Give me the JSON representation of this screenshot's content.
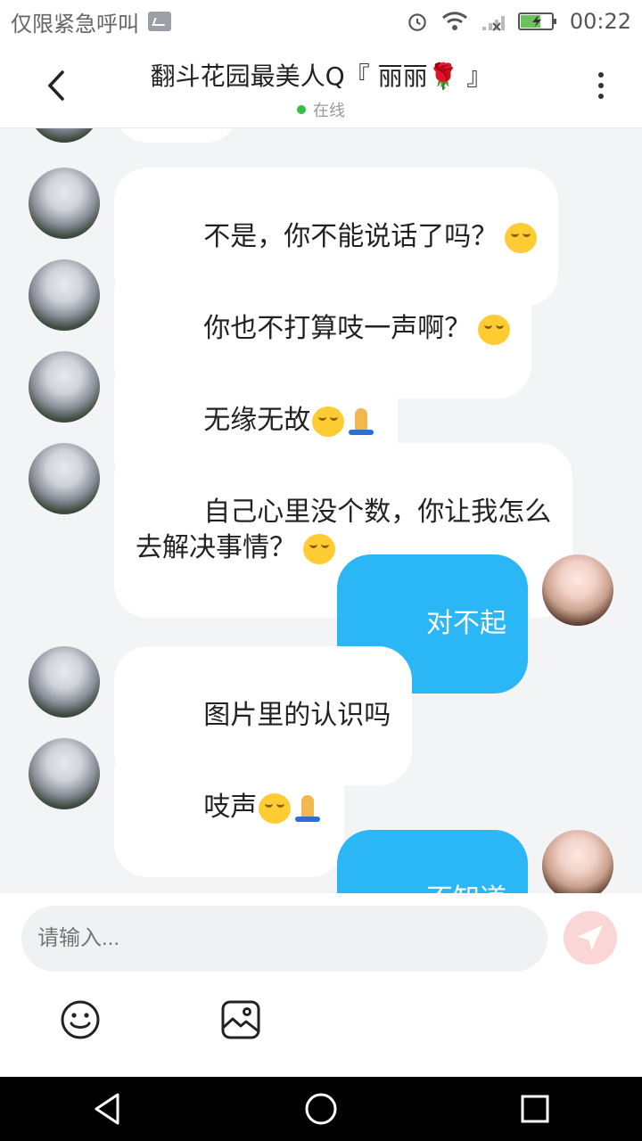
{
  "status_bar": {
    "left_text": "仅限紧急呼叫",
    "time": "00:22",
    "icons": [
      "alarm-icon",
      "wifi-icon",
      "signal-icon",
      "battery-charging-icon"
    ]
  },
  "header": {
    "title": "翻斗花园最美人Q『 丽丽🌹 』",
    "status": "在线",
    "online_color": "#31c14b"
  },
  "messages": [
    {
      "from": "other",
      "text": "不是，你不能说话了吗？",
      "emoji": [
        "smile"
      ]
    },
    {
      "from": "other",
      "text": "你也不打算吱一声啊？",
      "emoji": [
        "smile"
      ]
    },
    {
      "from": "other",
      "text": "无缘无故",
      "emoji": [
        "smile",
        "pray"
      ]
    },
    {
      "from": "other",
      "text": "自己心里没个数，你让我怎么\n去解决事情？",
      "emoji": [
        "smile"
      ]
    },
    {
      "from": "me",
      "text": "对不起"
    },
    {
      "from": "other",
      "text": "图片里的认识吗"
    },
    {
      "from": "other",
      "text": "吱声",
      "emoji": [
        "smile",
        "pray"
      ]
    },
    {
      "from": "me",
      "text": "不知道"
    }
  ],
  "composer": {
    "placeholder": "请输入...",
    "tools": [
      "emoji-icon",
      "image-icon"
    ],
    "send_color": "#fbd6d6"
  },
  "colors": {
    "accent": "#2bb6f5",
    "bg": "#f3f4f6"
  },
  "nav": [
    "back-triangle-icon",
    "home-circle-icon",
    "recents-square-icon"
  ]
}
